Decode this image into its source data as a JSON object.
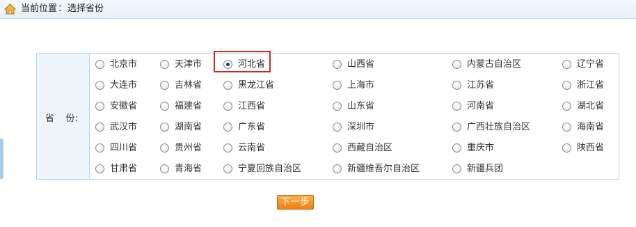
{
  "header": {
    "location_label": "当前位置",
    "separator": "：",
    "page_title": "选择省份"
  },
  "form": {
    "field_label": "省    份:",
    "selected_value": "河北省",
    "options": [
      [
        "北京市",
        "天津市",
        "河北省",
        "山西省",
        "内蒙古自治区",
        "辽宁省"
      ],
      [
        "大连市",
        "吉林省",
        "黑龙江省",
        "上海市",
        "江苏省",
        "浙江省"
      ],
      [
        "安徽省",
        "福建省",
        "江西省",
        "山东省",
        "河南省",
        "湖北省"
      ],
      [
        "武汉市",
        "湖南省",
        "广东省",
        "深圳市",
        "广西壮族自治区",
        "海南省"
      ],
      [
        "四川省",
        "贵州省",
        "云南省",
        "西藏自治区",
        "重庆市",
        "陕西省"
      ],
      [
        "甘肃省",
        "青海省",
        "宁夏回族自治区",
        "新疆维吾尔自治区",
        "新疆兵团"
      ]
    ]
  },
  "actions": {
    "next_label": "下一步"
  },
  "colors": {
    "accent_orange": "#ee7d13",
    "highlight_red": "#d0281f",
    "border_blue": "#bcd4e8"
  }
}
